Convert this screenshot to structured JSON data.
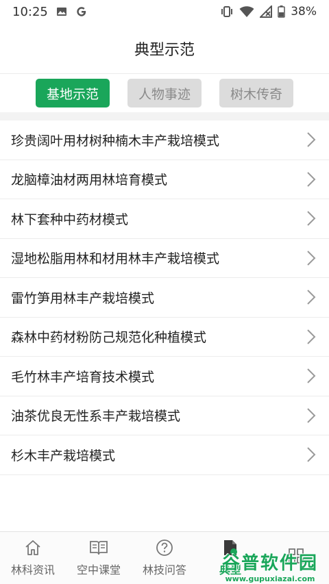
{
  "status_bar": {
    "time": "10:25",
    "battery": "38%",
    "icons": [
      "image-icon",
      "google-icon",
      "vibrate-icon",
      "wifi-icon",
      "signal-icon",
      "battery-icon"
    ]
  },
  "header": {
    "title": "典型示范"
  },
  "tabs": [
    {
      "label": "基地示范",
      "active": true
    },
    {
      "label": "人物事迹",
      "active": false
    },
    {
      "label": "树木传奇",
      "active": false
    }
  ],
  "list": {
    "items": [
      "珍贵阔叶用材树种楠木丰产栽培模式",
      "龙脑樟油材两用林培育模式",
      "林下套种中药材模式",
      "湿地松脂用林和材用林丰产栽培模式",
      "雷竹笋用林丰产栽培模式",
      "森林中药材粉防己规范化种植模式",
      "毛竹林丰产培育技术模式",
      "油茶优良无性系丰产栽培模式",
      "杉木丰产栽培模式"
    ]
  },
  "bottom_nav": [
    {
      "label": "林科资讯",
      "icon": "home-icon"
    },
    {
      "label": "空中课堂",
      "icon": "book-icon"
    },
    {
      "label": "林技问答",
      "icon": "question-icon"
    },
    {
      "label": "典型",
      "icon": "document-icon",
      "active": true
    },
    {
      "label": "",
      "icon": "grid-icon"
    }
  ],
  "watermark": {
    "main": "谷普软件园",
    "sub": "www.gupuxiazai.com"
  },
  "colors": {
    "accent": "#1aa65a",
    "tab_inactive_bg": "#dcdcdc",
    "tab_inactive_text": "#8a8a8a"
  }
}
